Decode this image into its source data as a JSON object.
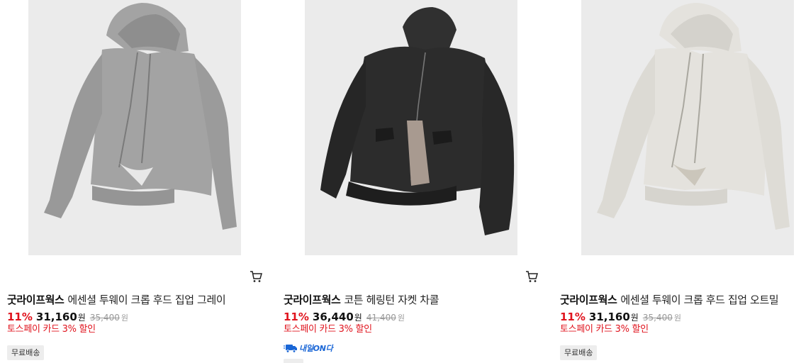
{
  "products": [
    {
      "brand": "굿라이프웍스",
      "name": "에센셜 투웨이 크롭 후드 집업 그레이",
      "discount": "11%",
      "price": "31,160",
      "currency": "원",
      "original_price": "35,400",
      "original_currency": "원",
      "promo": "토스페이 카드 3% 할인",
      "badge": "무료배송",
      "image_icon": "gray-zip-hoodie",
      "cart_icon": "cart-icon",
      "body_color": "#9e9e9e"
    },
    {
      "brand": "굿라이프웍스",
      "name": "코튼 헤링턴 자켓 차콜",
      "discount": "11%",
      "price": "36,440",
      "currency": "원",
      "original_price": "41,400",
      "original_currency": "원",
      "promo": "토스페이 카드 3% 할인",
      "delivery_label": "내일ON다",
      "image_icon": "charcoal-harrington-jacket",
      "body_color": "#2b2b2b"
    },
    {
      "brand": "굿라이프웍스",
      "name": "에센셜 투웨이 크롭 후드 집업 오트밀",
      "discount": "11%",
      "price": "31,160",
      "currency": "원",
      "original_price": "35,400",
      "original_currency": "원",
      "promo": "토스페이 카드 3% 할인",
      "badge": "무료배송",
      "image_icon": "oatmeal-zip-hoodie",
      "cart_icon": "cart-icon",
      "body_color": "#e3e1dc"
    }
  ],
  "colors": {
    "discount_red": "#e0141e",
    "brand_blue": "#1a66d6",
    "badge_bg": "#ededed"
  }
}
